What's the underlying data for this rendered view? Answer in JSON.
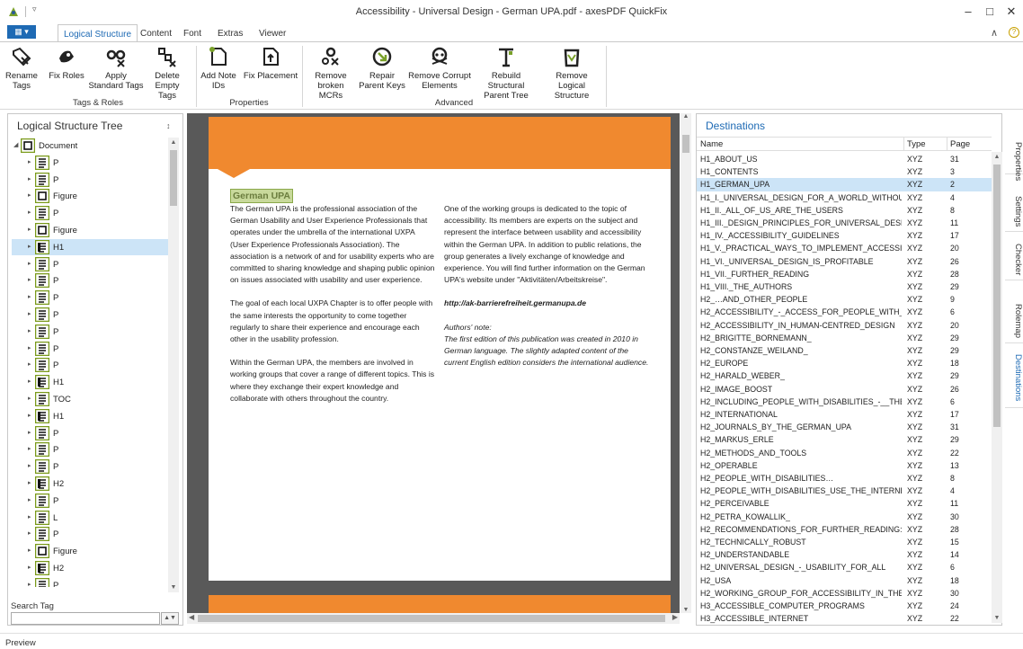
{
  "window": {
    "title": "Accessibility - Universal Design - German UPA.pdf - axesPDF QuickFix",
    "quick_access": "▿",
    "minimize": "–",
    "maximize": "□",
    "close": "✕"
  },
  "tabs": {
    "file_label": "▦ ▾",
    "items": [
      "Logical Structure",
      "Content",
      "Font",
      "Extras",
      "Viewer"
    ],
    "collapse": "∧",
    "help": "?"
  },
  "ribbon": {
    "buttons": [
      {
        "l1": "Rename",
        "l2": "Tags"
      },
      {
        "l1": "Fix Roles",
        "l2": ""
      },
      {
        "l1": "Apply",
        "l2": "Standard Tags"
      },
      {
        "l1": "Delete",
        "l2": "Empty Tags"
      },
      {
        "l1": "Add Note",
        "l2": "IDs"
      },
      {
        "l1": "Fix Placement",
        "l2": ""
      },
      {
        "l1": "Remove",
        "l2": "broken MCRs"
      },
      {
        "l1": "Repair",
        "l2": "Parent Keys"
      },
      {
        "l1": "Remove Corrupt",
        "l2": "Elements"
      },
      {
        "l1": "Rebuild Structural",
        "l2": "Parent Tree"
      },
      {
        "l1": "Remove Logical",
        "l2": "Structure"
      }
    ],
    "groups": [
      "Tags & Roles",
      "Properties",
      "Advanced"
    ]
  },
  "left_panel": {
    "title": "Logical Structure Tree",
    "pin": "↕",
    "tree": [
      {
        "label": "Document",
        "icon": "document-tag-icon",
        "expanded": true
      },
      {
        "label": "P",
        "icon": "paragraph-tag-icon"
      },
      {
        "label": "P",
        "icon": "paragraph-tag-icon"
      },
      {
        "label": "Figure",
        "icon": "figure-tag-icon"
      },
      {
        "label": "P",
        "icon": "paragraph-tag-icon"
      },
      {
        "label": "Figure",
        "icon": "figure-tag-icon"
      },
      {
        "label": "H1",
        "icon": "heading-tag-icon",
        "selected": true
      },
      {
        "label": "P",
        "icon": "paragraph-tag-icon"
      },
      {
        "label": "P",
        "icon": "paragraph-tag-icon"
      },
      {
        "label": "P",
        "icon": "paragraph-tag-icon"
      },
      {
        "label": "P",
        "icon": "paragraph-tag-icon"
      },
      {
        "label": "P",
        "icon": "paragraph-tag-icon"
      },
      {
        "label": "P",
        "icon": "paragraph-tag-icon"
      },
      {
        "label": "P",
        "icon": "paragraph-tag-icon"
      },
      {
        "label": "H1",
        "icon": "heading-tag-icon"
      },
      {
        "label": "TOC",
        "icon": "toc-tag-icon"
      },
      {
        "label": "H1",
        "icon": "heading-tag-icon"
      },
      {
        "label": "P",
        "icon": "paragraph-tag-icon"
      },
      {
        "label": "P",
        "icon": "paragraph-tag-icon"
      },
      {
        "label": "P",
        "icon": "paragraph-tag-icon"
      },
      {
        "label": "H2",
        "icon": "heading2-tag-icon"
      },
      {
        "label": "P",
        "icon": "paragraph-tag-icon"
      },
      {
        "label": "L",
        "icon": "list-tag-icon"
      },
      {
        "label": "P",
        "icon": "paragraph-tag-icon"
      },
      {
        "label": "Figure",
        "icon": "figure-tag-icon"
      },
      {
        "label": "H2",
        "icon": "heading2-tag-icon"
      },
      {
        "label": "P",
        "icon": "paragraph-tag-icon"
      }
    ],
    "search_label": "Search Tag",
    "search_value": ""
  },
  "document": {
    "heading": "German UPA",
    "left_col": [
      "The German UPA is the professional association of the German Usability and User Experience Professionals that operates under the umbrella of the international UXPA (User Experience Professionals Association). The association is a network of and for usability experts who are committed to sharing knowledge and shaping public opinion on issues associated with usability and user experience.",
      "The goal of each local UXPA Chapter is to offer people with the same interests the opportunity to come together regularly to share their experience and encourage each other in the usability profession.",
      "Within the German UPA, the members are involved in working groups that cover a range of different topics. This is where they exchange their expert knowledge and collaborate with others throughout the country."
    ],
    "right_col": [
      "One of the working groups is dedicated to the topic of accessibility. Its members are experts on the subject and represent the interface between usability and accessibility within the German UPA. In addition to public relations, the group generates a lively exchange of knowledge and experience. You will find further information on the German UPA's website under \"Aktivitäten/Arbeitskreise\"."
    ],
    "url": "http://ak-barrierefreiheit.germanupa.de",
    "note_title": "Authors' note:",
    "note_text": "The first edition of this publication was created in 2010 in German language. The slightly adapted content of the current English edition considers the international audience."
  },
  "destinations": {
    "title": "Destinations",
    "pin": "↕",
    "columns": [
      "Name",
      "Type",
      "Page"
    ],
    "rows": [
      [
        "H1_ABOUT_US",
        "XYZ",
        "31"
      ],
      [
        "H1_CONTENTS",
        "XYZ",
        "3"
      ],
      [
        "H1_GERMAN_UPA",
        "XYZ",
        "2"
      ],
      [
        "H1_I._UNIVERSAL_DESIGN_FOR_A_WORLD_WITHOU...",
        "XYZ",
        "4"
      ],
      [
        "H1_II._ALL_OF_US_ARE_THE_USERS",
        "XYZ",
        "8"
      ],
      [
        "H1_III._DESIGN_PRINCIPLES_FOR_UNIVERSAL_DESIGN",
        "XYZ",
        "11"
      ],
      [
        "H1_IV._ACCESSIBILITY_GUIDELINES",
        "XYZ",
        "17"
      ],
      [
        "H1_V._PRACTICAL_WAYS_TO_IMPLEMENT_ACCESSIBI...",
        "XYZ",
        "20"
      ],
      [
        "H1_VI._UNIVERSAL_DESIGN_IS_PROFITABLE",
        "XYZ",
        "26"
      ],
      [
        "H1_VII._FURTHER_READING",
        "XYZ",
        "28"
      ],
      [
        "H1_VIII._THE_AUTHORS",
        "XYZ",
        "29"
      ],
      [
        "H2_…AND_OTHER_PEOPLE",
        "XYZ",
        "9"
      ],
      [
        "H2_ACCESSIBILITY_-_ACCESS_FOR_PEOPLE_WITH_D...",
        "XYZ",
        "6"
      ],
      [
        "H2_ACCESSIBILITY_IN_HUMAN-CENTRED_DESIGN",
        "XYZ",
        "20"
      ],
      [
        "H2_BRIGITTE_BORNEMANN_",
        "XYZ",
        "29"
      ],
      [
        "H2_CONSTANZE_WEILAND_",
        "XYZ",
        "29"
      ],
      [
        "H2_EUROPE",
        "XYZ",
        "18"
      ],
      [
        "H2_HARALD_WEBER_",
        "XYZ",
        "29"
      ],
      [
        "H2_IMAGE_BOOST",
        "XYZ",
        "26"
      ],
      [
        "H2_INCLUDING_PEOPLE_WITH_DISABILITIES_-__THE...",
        "XYZ",
        "6"
      ],
      [
        "H2_INTERNATIONAL",
        "XYZ",
        "17"
      ],
      [
        "H2_JOURNALS_BY_THE_GERMAN_UPA",
        "XYZ",
        "31"
      ],
      [
        "H2_MARKUS_ERLE",
        "XYZ",
        "29"
      ],
      [
        "H2_METHODS_AND_TOOLS",
        "XYZ",
        "22"
      ],
      [
        "H2_OPERABLE",
        "XYZ",
        "13"
      ],
      [
        "H2_PEOPLE_WITH_DISABILITIES…",
        "XYZ",
        "8"
      ],
      [
        "H2_PEOPLE_WITH_DISABILITIES_USE_THE_INTERNET",
        "XYZ",
        "4"
      ],
      [
        "H2_PERCEIVABLE",
        "XYZ",
        "11"
      ],
      [
        "H2_PETRA_KOWALLIK_",
        "XYZ",
        "30"
      ],
      [
        "H2_RECOMMENDATIONS_FOR_FURTHER_READING:",
        "XYZ",
        "28"
      ],
      [
        "H2_TECHNICALLY_ROBUST",
        "XYZ",
        "15"
      ],
      [
        "H2_UNDERSTANDABLE",
        "XYZ",
        "14"
      ],
      [
        "H2_UNIVERSAL_DESIGN_-_USABILITY_FOR_ALL",
        "XYZ",
        "6"
      ],
      [
        "H2_USA",
        "XYZ",
        "18"
      ],
      [
        "H2_WORKING_GROUP_FOR_ACCESSIBILITY_IN_THE_...",
        "XYZ",
        "30"
      ],
      [
        "H3_ACCESSIBLE_COMPUTER_PROGRAMS",
        "XYZ",
        "24"
      ],
      [
        "H3_ACCESSIBLE_INTERNET",
        "XYZ",
        "22"
      ]
    ],
    "selected_index": 2
  },
  "side_tabs": [
    "Properties",
    "Settings",
    "Checker",
    "Rolemap",
    "Destinations"
  ],
  "status": {
    "text": "Preview"
  },
  "colors": {
    "accent": "#1e6ab4",
    "selection": "#cce4f7",
    "tag_icon": "#7a9a1a",
    "page_orange": "#f0892f"
  }
}
